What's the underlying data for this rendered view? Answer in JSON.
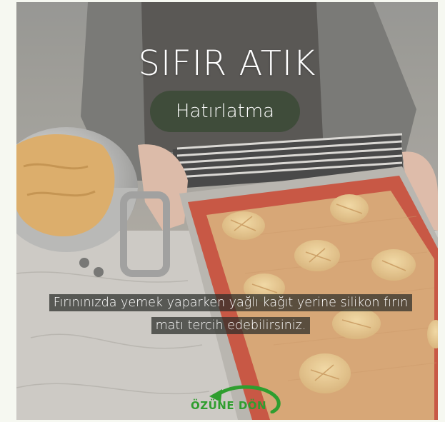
{
  "poster": {
    "title": "SIFIR ATIK",
    "badge": "Hatırlatma",
    "caption_line1": "Fırınınızda yemek yaparken yağlı kağıt yerine silikon fırın",
    "caption_line2": "matı tercih edebilirsiniz.",
    "logo_text": "ÖZÜNE DÖN"
  },
  "colors": {
    "badge_bg": "#3f4c3a",
    "mat_red": "#c44a36",
    "mat_inner": "#d4a06c",
    "logo_green": "#2f9e2f"
  }
}
